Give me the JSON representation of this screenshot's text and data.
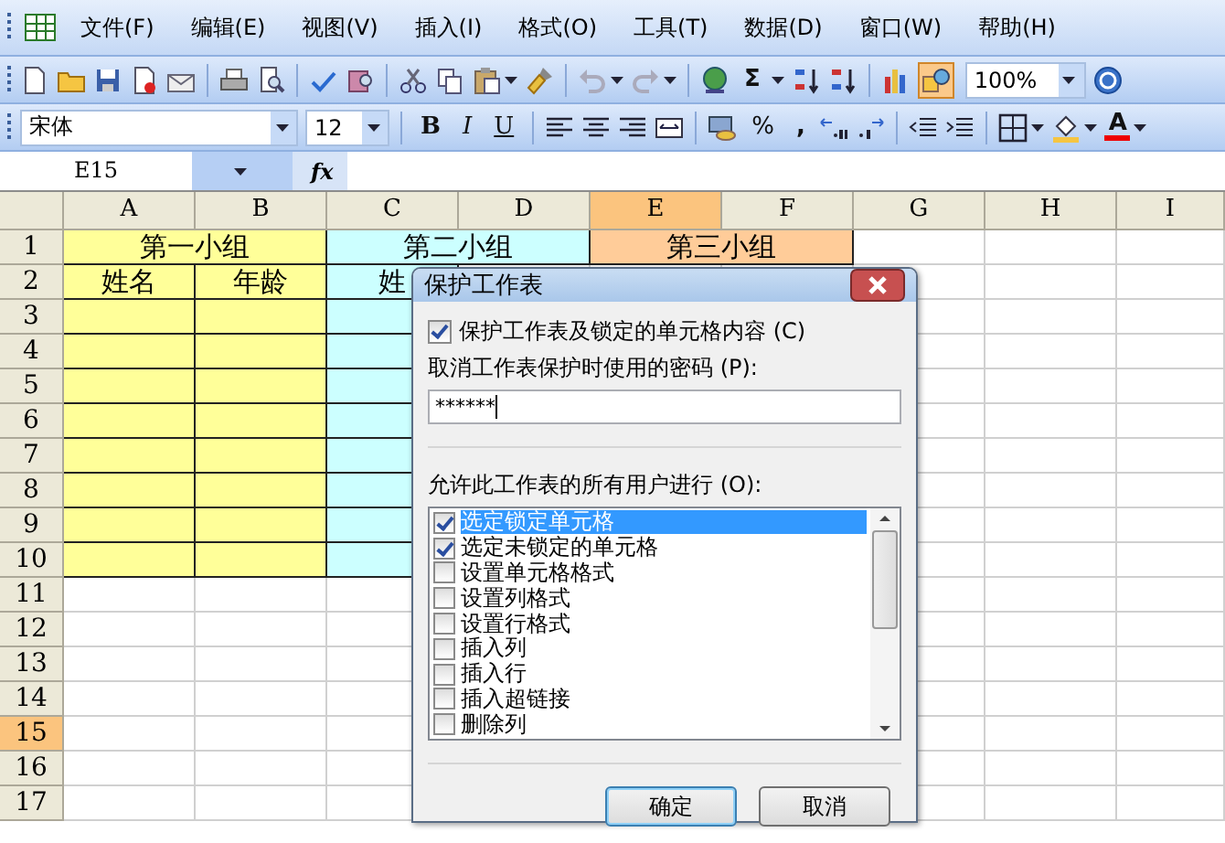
{
  "menu_bar": {
    "items": [
      "文件(F)",
      "编辑(E)",
      "视图(V)",
      "插入(I)",
      "格式(O)",
      "工具(T)",
      "数据(D)",
      "窗口(W)",
      "帮助(H)"
    ]
  },
  "standard_toolbar": {
    "sum_symbol": "Σ",
    "zoom": "100%"
  },
  "formatting_toolbar": {
    "font": "宋体",
    "font_size": "12",
    "bold": "B",
    "italic": "I",
    "underline": "U",
    "percent": "%",
    "comma": ",",
    "font_color": "A"
  },
  "formula_bar": {
    "name_box": "E15",
    "function_label": "fx"
  },
  "sheet": {
    "columns": [
      {
        "label": "A",
        "selected": false
      },
      {
        "label": "B",
        "selected": false
      },
      {
        "label": "C",
        "selected": false
      },
      {
        "label": "D",
        "selected": false
      },
      {
        "label": "E",
        "selected": true
      },
      {
        "label": "F",
        "selected": false
      },
      {
        "label": "G",
        "selected": false
      },
      {
        "label": "H",
        "selected": false
      },
      {
        "label": "I",
        "selected": false
      }
    ],
    "rows": [
      {
        "label": "1",
        "selected": false,
        "cells": [
          {
            "text": "第一小组",
            "color": "#ffff99",
            "merged": true
          },
          {
            "text": "第二小组",
            "color": "#ccffff",
            "merged": true
          },
          {
            "text": "第三小组",
            "color": "#ffcc99",
            "merged": true
          }
        ]
      },
      {
        "label": "2",
        "selected": false,
        "cells": [
          {
            "text": "姓名",
            "color": "#ffff99"
          },
          {
            "text": "年龄",
            "color": "#ffff99"
          },
          {
            "text": "姓",
            "color": "#ccffff"
          }
        ]
      },
      {
        "label": "3",
        "selected": false,
        "cells": [
          {
            "color": "#ffff99"
          },
          {
            "color": "#ffff99"
          },
          {
            "color": "#ccffff"
          }
        ]
      },
      {
        "label": "4",
        "selected": false,
        "cells": [
          {
            "color": "#ffff99"
          },
          {
            "color": "#ffff99"
          },
          {
            "color": "#ccffff"
          }
        ]
      },
      {
        "label": "5",
        "selected": false,
        "cells": [
          {
            "color": "#ffff99"
          },
          {
            "color": "#ffff99"
          },
          {
            "color": "#ccffff"
          }
        ]
      },
      {
        "label": "6",
        "selected": false,
        "cells": [
          {
            "color": "#ffff99"
          },
          {
            "color": "#ffff99"
          },
          {
            "color": "#ccffff"
          }
        ]
      },
      {
        "label": "7",
        "selected": false,
        "cells": [
          {
            "color": "#ffff99"
          },
          {
            "color": "#ffff99"
          },
          {
            "color": "#ccffff"
          }
        ]
      },
      {
        "label": "8",
        "selected": false,
        "cells": [
          {
            "color": "#ffff99"
          },
          {
            "color": "#ffff99"
          },
          {
            "color": "#ccffff"
          }
        ]
      },
      {
        "label": "9",
        "selected": false,
        "cells": [
          {
            "color": "#ffff99"
          },
          {
            "color": "#ffff99"
          },
          {
            "color": "#ccffff"
          }
        ]
      },
      {
        "label": "10",
        "selected": false,
        "cells": [
          {
            "color": "#ffff99"
          },
          {
            "color": "#ffff99"
          },
          {
            "color": "#ccffff"
          }
        ]
      },
      {
        "label": "11",
        "selected": false
      },
      {
        "label": "12",
        "selected": false
      },
      {
        "label": "13",
        "selected": false
      },
      {
        "label": "14",
        "selected": false
      },
      {
        "label": "15",
        "selected": true
      },
      {
        "label": "16",
        "selected": false
      },
      {
        "label": "17",
        "selected": false
      }
    ]
  },
  "dialog": {
    "title": "保护工作表",
    "protect_option": {
      "label": "保护工作表及锁定的单元格内容 (C)",
      "checked": true
    },
    "password_label": "取消工作表保护时使用的密码 (P):",
    "password": "******",
    "permissions_label": "允许此工作表的所有用户进行 (O):",
    "permissions": [
      {
        "label": "选定锁定单元格",
        "checked": true,
        "selected": true
      },
      {
        "label": "选定未锁定的单元格",
        "checked": true,
        "selected": false
      },
      {
        "label": "设置单元格格式",
        "checked": false,
        "selected": false
      },
      {
        "label": "设置列格式",
        "checked": false,
        "selected": false
      },
      {
        "label": "设置行格式",
        "checked": false,
        "selected": false
      },
      {
        "label": "插入列",
        "checked": false,
        "selected": false
      },
      {
        "label": "插入行",
        "checked": false,
        "selected": false
      },
      {
        "label": "插入超链接",
        "checked": false,
        "selected": false
      },
      {
        "label": "删除列",
        "checked": false,
        "selected": false
      }
    ],
    "buttons": [
      {
        "label": "确定",
        "default": true
      },
      {
        "label": "取消",
        "default": false
      }
    ]
  }
}
